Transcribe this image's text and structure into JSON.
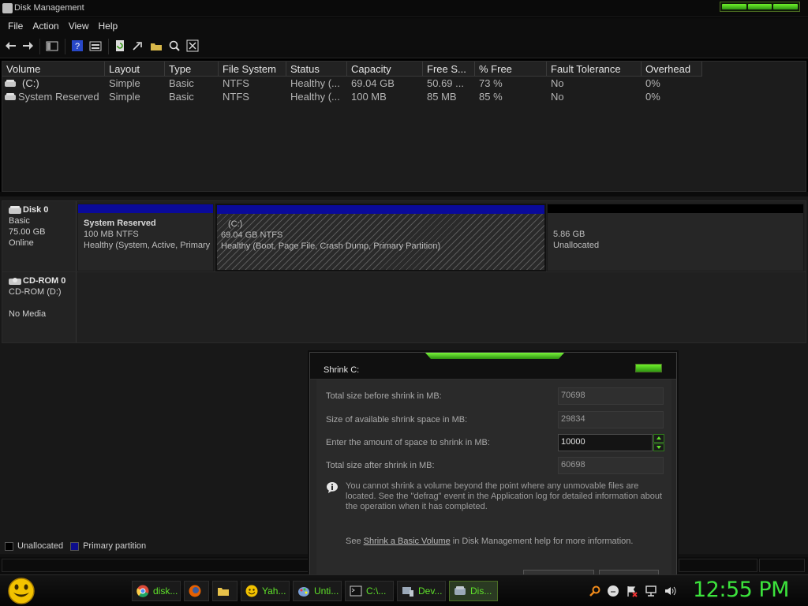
{
  "window": {
    "title": "Disk Management"
  },
  "menu": [
    "File",
    "Action",
    "View",
    "Help"
  ],
  "toolbar": {
    "icons": [
      "back-arrow-icon",
      "forward-arrow-icon",
      "console-tree-icon",
      "help-icon",
      "properties-icon",
      "refresh-icon",
      "export-icon",
      "open-icon",
      "rescan-icon",
      "settings-icon"
    ]
  },
  "volume_list": {
    "columns": [
      "Volume",
      "Layout",
      "Type",
      "File System",
      "Status",
      "Capacity",
      "Free S...",
      "% Free",
      "Fault Tolerance",
      "Overhead"
    ],
    "rows": [
      {
        "volume": "(C:)",
        "layout": "Simple",
        "type": "Basic",
        "fs": "NTFS",
        "status": "Healthy (...",
        "capacity": "69.04 GB",
        "free": "50.69 ...",
        "pct_free": "73 %",
        "fault": "No",
        "overhead": "0%"
      },
      {
        "volume": "System Reserved",
        "layout": "Simple",
        "type": "Basic",
        "fs": "NTFS",
        "status": "Healthy (...",
        "capacity": "100 MB",
        "free": "85 MB",
        "pct_free": "85 %",
        "fault": "No",
        "overhead": "0%"
      }
    ]
  },
  "disks": [
    {
      "name": "Disk 0",
      "type": "Basic",
      "size": "75.00 GB",
      "status": "Online",
      "partitions": [
        {
          "name": "System Reserved",
          "fs": "100 MB NTFS",
          "status": "Healthy (System, Active, Primary"
        },
        {
          "name": "(C:)",
          "fs": "69.04 GB NTFS",
          "status": "Healthy (Boot, Page File, Crash Dump, Primary Partition)"
        },
        {
          "size": "5.86 GB",
          "status": "Unallocated"
        }
      ]
    },
    {
      "name": "CD-ROM 0",
      "type": "CD-ROM (D:)",
      "status": "No Media"
    }
  ],
  "legend": [
    {
      "label": "Unallocated",
      "color": "#000000"
    },
    {
      "label": "Primary partition",
      "color": "#0d0d8c"
    }
  ],
  "colors": {
    "primary_bar": "#0a0a9a",
    "unalloc_bar": "#000000",
    "accent_green": "#5fe02a"
  },
  "dialog": {
    "title": "Shrink C:",
    "fields": [
      {
        "label": "Total size before shrink in MB:",
        "value": "70698"
      },
      {
        "label": "Size of available shrink space in MB:",
        "value": "29834"
      },
      {
        "label": "Enter the amount of space to shrink in MB:",
        "value": "10000"
      },
      {
        "label": "Total size after shrink in MB:",
        "value": "60698"
      }
    ],
    "info": "You cannot shrink a volume beyond the point where any unmovable files are located. See the \"defrag\" event in the Application log for detailed information about the operation when it has completed.",
    "see_prefix": "See",
    "see_link": "Shrink a Basic Volume",
    "see_suffix": "in Disk Management help for more information."
  },
  "taskbar": {
    "buttons": [
      {
        "label": "disk...",
        "icon": "chrome-icon",
        "color": "#dd4b39"
      },
      {
        "label": "",
        "icon": "firefox-icon",
        "color": "#e66000"
      },
      {
        "label": "",
        "icon": "folder-icon",
        "color": "#e8c24a"
      },
      {
        "label": "Yah...",
        "icon": "yahoo-messenger-icon",
        "color": "#f2c200"
      },
      {
        "label": "Unti...",
        "icon": "paint-icon",
        "color": "#7aa0d8"
      },
      {
        "label": "C:\\...",
        "icon": "cmd-icon",
        "color": "#cccccc"
      },
      {
        "label": "Dev...",
        "icon": "device-manager-icon",
        "color": "#9aa8b8"
      },
      {
        "label": "Dis...",
        "icon": "disk-management-icon",
        "color": "#9aa8b8"
      }
    ],
    "clock": "12:55 PM"
  }
}
